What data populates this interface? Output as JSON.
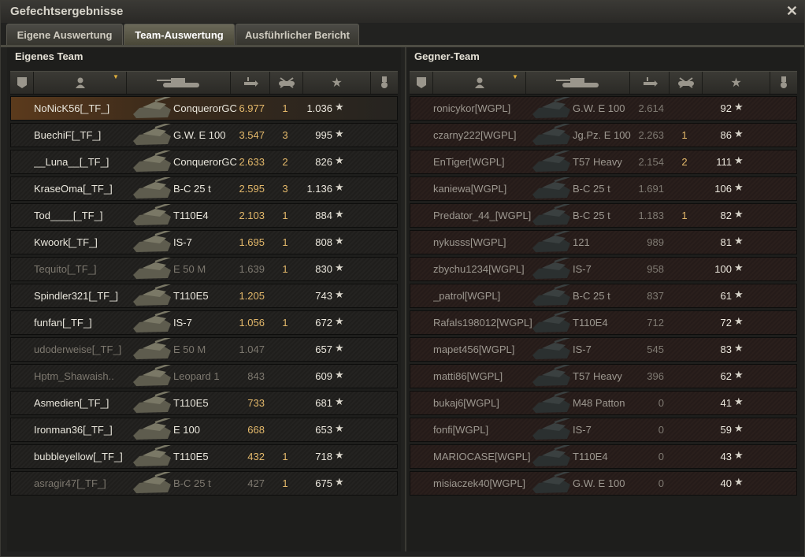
{
  "window": {
    "title": "Gefechtsergebnisse"
  },
  "tabs": [
    {
      "label": "Eigene Auswertung",
      "active": false
    },
    {
      "label": "Team-Auswertung",
      "active": true
    },
    {
      "label": "Ausführlicher Bericht",
      "active": false
    }
  ],
  "columns": [
    "squad-icon",
    "player-icon",
    "tank-icon",
    "damage-icon",
    "kills-icon",
    "xp-star-icon",
    "medal-icon"
  ],
  "colors": {
    "accent": "#e3b86a",
    "own_row": "#242321",
    "enemy_row": "#2a1f1c",
    "highlight_row": "#5b3a1c"
  },
  "own_team": {
    "title": "Eigenes Team",
    "rows": [
      {
        "player": "NoNicK56[_TF_]",
        "vehicle": "ConquerorGC",
        "damage": "6.977",
        "kills": "1",
        "xp": "1.036",
        "dead": false
      },
      {
        "player": "BuechiF[_TF_]",
        "vehicle": "G.W. E 100",
        "damage": "3.547",
        "kills": "3",
        "xp": "995",
        "dead": false
      },
      {
        "player": "__Luna__[_TF_]",
        "vehicle": "ConquerorGC",
        "damage": "2.633",
        "kills": "2",
        "xp": "826",
        "dead": false
      },
      {
        "player": "KraseOma[_TF_]",
        "vehicle": "B-C 25 t",
        "damage": "2.595",
        "kills": "3",
        "xp": "1.136",
        "dead": false
      },
      {
        "player": "Tod____[_TF_]",
        "vehicle": "T110E4",
        "damage": "2.103",
        "kills": "1",
        "xp": "884",
        "dead": false
      },
      {
        "player": "Kwoork[_TF_]",
        "vehicle": "IS-7",
        "damage": "1.695",
        "kills": "1",
        "xp": "808",
        "dead": false
      },
      {
        "player": "Tequito[_TF_]",
        "vehicle": "E 50 M",
        "damage": "1.639",
        "kills": "1",
        "xp": "830",
        "dead": true
      },
      {
        "player": "Spindler321[_TF_]",
        "vehicle": "T110E5",
        "damage": "1.205",
        "kills": "",
        "xp": "743",
        "dead": false
      },
      {
        "player": "funfan[_TF_]",
        "vehicle": "IS-7",
        "damage": "1.056",
        "kills": "1",
        "xp": "672",
        "dead": false
      },
      {
        "player": "udoderweise[_TF_]",
        "vehicle": "E 50 M",
        "damage": "1.047",
        "kills": "",
        "xp": "657",
        "dead": true
      },
      {
        "player": "Hptm_Shawaish..",
        "vehicle": "Leopard 1",
        "damage": "843",
        "kills": "",
        "xp": "609",
        "dead": true
      },
      {
        "player": "Asmedien[_TF_]",
        "vehicle": "T110E5",
        "damage": "733",
        "kills": "",
        "xp": "681",
        "dead": false
      },
      {
        "player": "Ironman36[_TF_]",
        "vehicle": "E 100",
        "damage": "668",
        "kills": "",
        "xp": "653",
        "dead": false
      },
      {
        "player": "bubbleyellow[_TF_]",
        "vehicle": "T110E5",
        "damage": "432",
        "kills": "1",
        "xp": "718",
        "dead": false
      },
      {
        "player": "asragir47[_TF_]",
        "vehicle": "B-C 25 t",
        "damage": "427",
        "kills": "1",
        "xp": "675",
        "dead": true
      }
    ]
  },
  "enemy_team": {
    "title": "Gegner-Team",
    "rows": [
      {
        "player": "ronicykor[WGPL]",
        "vehicle": "G.W. E 100",
        "damage": "2.614",
        "kills": "",
        "xp": "92"
      },
      {
        "player": "czarny222[WGPL]",
        "vehicle": "Jg.Pz. E 100",
        "damage": "2.263",
        "kills": "1",
        "xp": "86"
      },
      {
        "player": "EnTiger[WGPL]",
        "vehicle": "T57 Heavy",
        "damage": "2.154",
        "kills": "2",
        "xp": "111"
      },
      {
        "player": "kaniewa[WGPL]",
        "vehicle": "B-C 25 t",
        "damage": "1.691",
        "kills": "",
        "xp": "106"
      },
      {
        "player": "Predator_44_[WGPL]",
        "vehicle": "B-C 25 t",
        "damage": "1.183",
        "kills": "1",
        "xp": "82"
      },
      {
        "player": "nykusss[WGPL]",
        "vehicle": "121",
        "damage": "989",
        "kills": "",
        "xp": "81"
      },
      {
        "player": "zbychu1234[WGPL]",
        "vehicle": "IS-7",
        "damage": "958",
        "kills": "",
        "xp": "100"
      },
      {
        "player": "_patrol[WGPL]",
        "vehicle": "B-C 25 t",
        "damage": "837",
        "kills": "",
        "xp": "61"
      },
      {
        "player": "Rafals198012[WGPL]",
        "vehicle": "T110E4",
        "damage": "712",
        "kills": "",
        "xp": "72"
      },
      {
        "player": "mapet456[WGPL]",
        "vehicle": "IS-7",
        "damage": "545",
        "kills": "",
        "xp": "83"
      },
      {
        "player": "matti86[WGPL]",
        "vehicle": "T57 Heavy",
        "damage": "396",
        "kills": "",
        "xp": "62"
      },
      {
        "player": "bukaj6[WGPL]",
        "vehicle": "M48 Patton",
        "damage": "0",
        "kills": "",
        "xp": "41"
      },
      {
        "player": "fonfi[WGPL]",
        "vehicle": "IS-7",
        "damage": "0",
        "kills": "",
        "xp": "59"
      },
      {
        "player": "MARIOCASE[WGPL]",
        "vehicle": "T110E4",
        "damage": "0",
        "kills": "",
        "xp": "43"
      },
      {
        "player": "misiaczek40[WGPL]",
        "vehicle": "G.W. E 100",
        "damage": "0",
        "kills": "",
        "xp": "40"
      }
    ]
  },
  "icons": {
    "star": "★",
    "close": "✕"
  }
}
